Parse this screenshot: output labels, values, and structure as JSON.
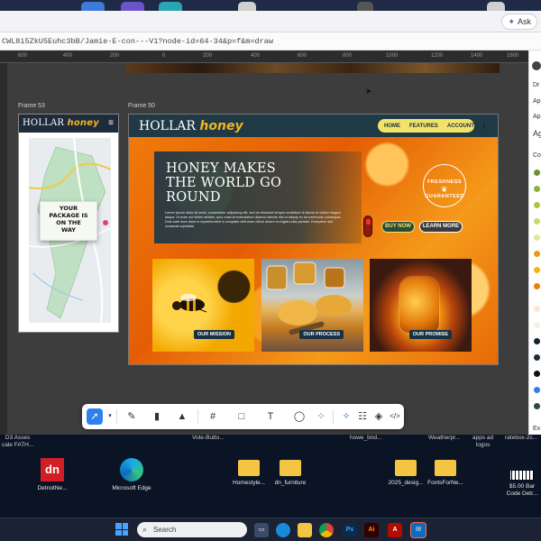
{
  "browser": {
    "ask_label": "Ask",
    "url": "CWL8i5ZkU5Euhc3bB/Jamie-E-con---V1?node-id=64-34&p=f&m=draw"
  },
  "canvas": {
    "ruler_ticks": [
      "600",
      "400",
      "200",
      "0",
      "200",
      "400",
      "600",
      "800",
      "1000",
      "1200",
      "1400",
      "1600"
    ],
    "frame_mobile_label": "Frame 53",
    "frame_desktop_label": "Frame 50"
  },
  "mobile": {
    "logo_main": "HOLLAR",
    "logo_accent": "honey",
    "menu_icon": "≡",
    "package_lines": [
      "YOUR",
      "PACKAGE IS",
      "ON THE",
      "WAY"
    ]
  },
  "desktop_frame": {
    "logo_main": "HOLLAR",
    "logo_accent": "honey",
    "nav": [
      "HOME",
      "FEATURES",
      "ACCOUNT"
    ],
    "hero_title": "HONEY MAKES THE WORLD GO ROUND",
    "hero_body": "Lorem ipsum dolor sit amet, consectetur adipiscing elit, sed do eiusmod tempor incididunt ut labore et dolore magna aliqua. Ut enim ad minim veniam, quis nostrud exercitation ullamco laboris nisi ut aliquip ex ea commodo consequat. Duis aute irure dolor in reprehenderit in voluptate velit esse cillum dolore eu fugiat nulla pariatur. Excepteur sint occaecat cupidatat",
    "badge_top": "FRESHNESS",
    "badge_bottom": "GUARANTEED",
    "buy_button": "BUY NOW",
    "learn_button": "LEARN MORE",
    "cards": [
      "OUR MISSION",
      "OUR PROCESS",
      "OUR PROMISE"
    ]
  },
  "panel": {
    "labels": [
      "Dr",
      "Ap",
      "Ap",
      "Ag",
      "Co",
      "Ex"
    ],
    "swatches": [
      "#6e8f3a",
      "#8fb140",
      "#a7c94a",
      "#c4dc6b",
      "#d9ea9a",
      "#e89b1a",
      "#f3b51f",
      "#f07d0b",
      "#fbe7d2",
      "#f6efe3",
      "#0f2430",
      "#1d2b3a",
      "#101010",
      "#2f80ed",
      "#2b4a3a"
    ]
  },
  "toolbar": {
    "tools": [
      "move",
      "pen",
      "marker",
      "highlighter",
      "frame",
      "rectangle",
      "text",
      "comment",
      "components",
      "magic",
      "dev",
      "code"
    ]
  },
  "desktop": {
    "top_labels": [
      "D3 Asses",
      "cale FATH...",
      "Vote-Butto...",
      "howe_bnd...",
      "Weatherpr...",
      "apps ad",
      "logos",
      "ratebox-2c..."
    ],
    "icons": [
      {
        "label": "DetroitNe...",
        "kind": "dn"
      },
      {
        "label": "Microsoft Edge",
        "kind": "edge"
      },
      {
        "label": "Homestyle...",
        "kind": "folder"
      },
      {
        "label": "dn_furniture",
        "kind": "folder"
      },
      {
        "label": "2025_desig...",
        "kind": "folder"
      },
      {
        "label": "FontsForNe...",
        "kind": "folder"
      },
      {
        "label": "$5.00 Bar Code Detr...",
        "kind": "barcode"
      }
    ]
  },
  "taskbar": {
    "search_placeholder": "Search",
    "apps": [
      "file-explorer",
      "edge",
      "files",
      "chrome",
      "photoshop",
      "illustrator",
      "acrobat",
      "mail"
    ]
  }
}
